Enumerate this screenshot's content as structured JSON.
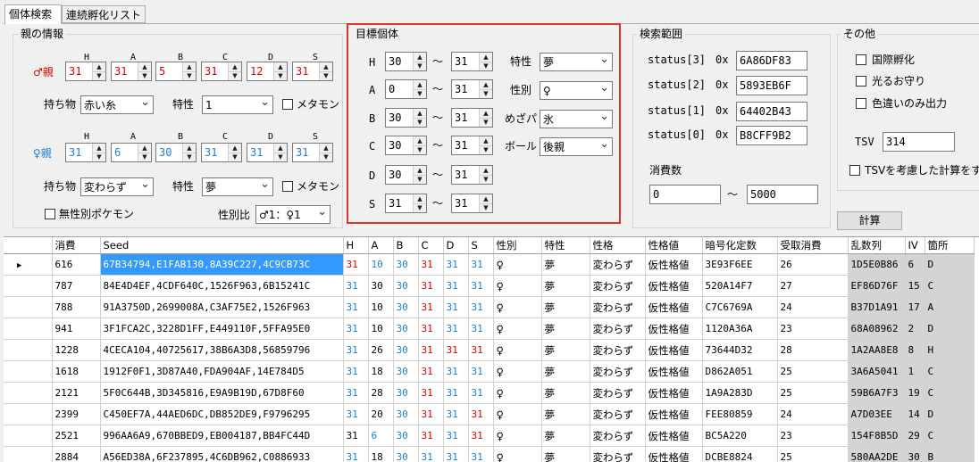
{
  "tabs": [
    {
      "label": "個体検索"
    },
    {
      "label": "連続孵化リスト"
    }
  ],
  "parents": {
    "title": "親の情報",
    "headers": [
      "H",
      "A",
      "B",
      "C",
      "D",
      "S"
    ],
    "male": {
      "label": "♂親",
      "ivs": [
        "31",
        "31",
        "5",
        "31",
        "12",
        "31"
      ],
      "item_label": "持ち物",
      "item": "赤い糸",
      "nature_label": "特性",
      "ability": "1",
      "ditto_label": "メタモン"
    },
    "female": {
      "label": "♀親",
      "ivs": [
        "31",
        "6",
        "30",
        "31",
        "31",
        "31"
      ],
      "item_label": "持ち物",
      "item": "変わらず",
      "nature_label": "特性",
      "ability": "夢",
      "ditto_label": "メタモン"
    },
    "genderless_label": "無性別ポケモン",
    "ratio_label": "性別比",
    "ratio": "♂1：♀1"
  },
  "target": {
    "title": "目標個体",
    "rows": [
      {
        "stat": "H",
        "min": "30",
        "max": "31"
      },
      {
        "stat": "A",
        "min": "0",
        "max": "31"
      },
      {
        "stat": "B",
        "min": "30",
        "max": "31"
      },
      {
        "stat": "C",
        "min": "30",
        "max": "31"
      },
      {
        "stat": "D",
        "min": "30",
        "max": "31"
      },
      {
        "stat": "S",
        "min": "31",
        "max": "31"
      }
    ],
    "tilde": "～",
    "ability_label": "特性",
    "ability": "夢",
    "gender_label": "性別",
    "gender": "♀",
    "hp_label": "めざパ",
    "hp": "氷",
    "ball_label": "ボール",
    "ball": "後親"
  },
  "range": {
    "title": "検索範囲",
    "status": [
      {
        "label": "status[3]",
        "prefix": "0x",
        "value": "6A86DF83"
      },
      {
        "label": "status[2]",
        "prefix": "0x",
        "value": "5893EB6F"
      },
      {
        "label": "status[1]",
        "prefix": "0x",
        "value": "64402B43"
      },
      {
        "label": "status[0]",
        "prefix": "0x",
        "value": "B8CFF9B2"
      }
    ],
    "consume_label": "消費数",
    "from": "0",
    "tilde": "～",
    "to": "5000"
  },
  "other": {
    "title": "その他",
    "international": "国際孵化",
    "charm": "光るお守り",
    "shiny_only": "色違いのみ出力",
    "tsv_label": "TSV",
    "tsv": "314",
    "tsv_consider": "TSVを考慮した計算をす"
  },
  "calc_button": "計算",
  "grid": {
    "columns": [
      "消費",
      "Seed",
      "H",
      "A",
      "B",
      "C",
      "D",
      "S",
      "性別",
      "特性",
      "性格",
      "性格値",
      "暗号化定数",
      "受取消費",
      "乱数列",
      "IV",
      "箇所"
    ],
    "rows": [
      {
        "c": [
          "616",
          "67B34794,E1FAB130,8A39C227,4C9CB73C",
          "31",
          "10",
          "30",
          "31",
          "31",
          "31",
          "♀",
          "夢",
          "変わらず",
          "仮性格値",
          "3E93F6EE",
          "26",
          "1D5E0B86",
          "6",
          "D"
        ],
        "k": [
          "r",
          "b",
          "b",
          "r",
          "b",
          "b"
        ]
      },
      {
        "c": [
          "787",
          "84E4D4EF,4CDF640C,1526F963,6B15241C",
          "31",
          "30",
          "30",
          "31",
          "31",
          "31",
          "♀",
          "夢",
          "変わらず",
          "仮性格値",
          "520A14F7",
          "27",
          "EF86D76F",
          "15",
          "C"
        ],
        "k": [
          "b",
          "",
          "b",
          "r",
          "b",
          "b"
        ]
      },
      {
        "c": [
          "788",
          "91A3750D,2699008A,C3AF75E2,1526F963",
          "31",
          "10",
          "30",
          "31",
          "31",
          "31",
          "♀",
          "夢",
          "変わらず",
          "仮性格値",
          "C7C6769A",
          "24",
          "B37D1A91",
          "17",
          "A"
        ],
        "k": [
          "b",
          "",
          "b",
          "r",
          "b",
          "b"
        ]
      },
      {
        "c": [
          "941",
          "3F1FCA2C,3228D1FF,E449110F,5FFA95E0",
          "31",
          "10",
          "30",
          "31",
          "31",
          "31",
          "♀",
          "夢",
          "変わらず",
          "仮性格値",
          "1120A36A",
          "23",
          "68A08962",
          "2",
          "D"
        ],
        "k": [
          "b",
          "",
          "b",
          "r",
          "b",
          "b"
        ]
      },
      {
        "c": [
          "1228",
          "4CECA104,40725617,38B6A3D8,56859796",
          "31",
          "26",
          "30",
          "31",
          "31",
          "31",
          "♀",
          "夢",
          "変わらず",
          "仮性格値",
          "73644D32",
          "28",
          "1A2AA8E8",
          "8",
          "H"
        ],
        "k": [
          "b",
          "",
          "b",
          "r",
          "r",
          "r"
        ]
      },
      {
        "c": [
          "1618",
          "1912F0F1,3D87A40,FDA904AF,14E784D5",
          "31",
          "18",
          "30",
          "31",
          "31",
          "31",
          "♀",
          "夢",
          "変わらず",
          "仮性格値",
          "D862A051",
          "25",
          "3A6A5041",
          "1",
          "C"
        ],
        "k": [
          "b",
          "",
          "b",
          "r",
          "b",
          "b"
        ]
      },
      {
        "c": [
          "2121",
          "5F0C644B,3D345816,E9A9B19D,67D8F60",
          "31",
          "28",
          "30",
          "31",
          "31",
          "31",
          "♀",
          "夢",
          "変わらず",
          "仮性格値",
          "1A9A283D",
          "25",
          "59B6A7F3",
          "19",
          "C"
        ],
        "k": [
          "b",
          "",
          "b",
          "r",
          "b",
          "b"
        ]
      },
      {
        "c": [
          "2399",
          "C450EF7A,44AED6DC,DB852DE9,F9796295",
          "31",
          "20",
          "30",
          "31",
          "31",
          "31",
          "♀",
          "夢",
          "変わらず",
          "仮性格値",
          "FEE80859",
          "24",
          "A7D03EE",
          "14",
          "D"
        ],
        "k": [
          "b",
          "",
          "b",
          "r",
          "b",
          "r"
        ]
      },
      {
        "c": [
          "2521",
          "996AA6A9,670BBED9,EB004187,BB4FC44D",
          "31",
          "6",
          "30",
          "31",
          "31",
          "31",
          "♀",
          "夢",
          "変わらず",
          "仮性格値",
          "BC5A220",
          "23",
          "154F8B5D",
          "29",
          "C"
        ],
        "k": [
          "",
          "b",
          "b",
          "r",
          "b",
          "r"
        ]
      },
      {
        "c": [
          "2884",
          "A56ED38A,6F237895,4C6DB962,C0886933",
          "31",
          "18",
          "30",
          "31",
          "31",
          "31",
          "♀",
          "夢",
          "変わらず",
          "仮性格値",
          "DCBE8824",
          "25",
          "580AA2DE",
          "30",
          "B"
        ],
        "k": [
          "b",
          "",
          "b",
          "b",
          "b",
          "b"
        ]
      }
    ]
  },
  "colors": {
    "red": "#e00000",
    "blue": "#1e7fd6",
    "highlight": "#e03030",
    "selection": "#3399ff"
  }
}
